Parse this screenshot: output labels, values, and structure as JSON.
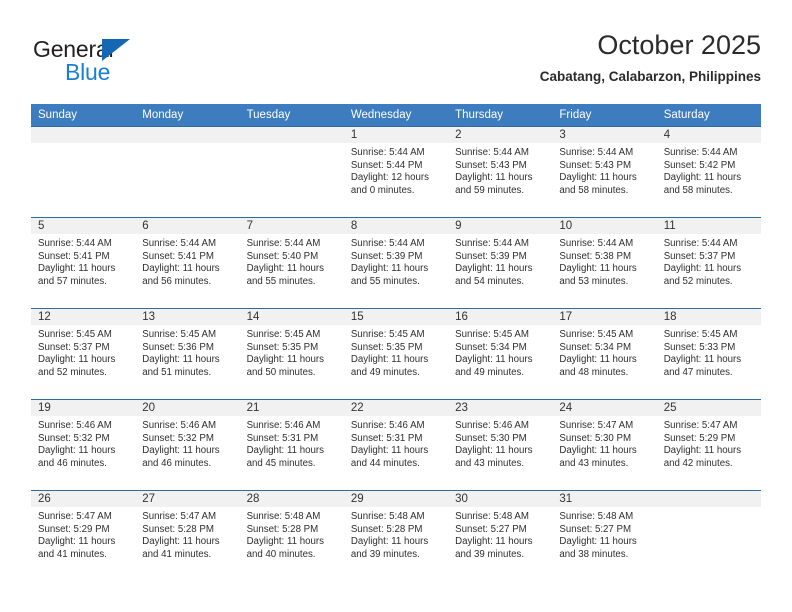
{
  "brand": {
    "name_top": "General",
    "name_bottom": "Blue",
    "triangle_color": "#1567b3",
    "blue_text_color": "#1a7fd4"
  },
  "header": {
    "title": "October 2025",
    "subtitle": "Cabatang, Calabarzon, Philippines"
  },
  "theme": {
    "header_row_bg": "#3c7cbf",
    "row_border": "#2e6da4",
    "daynum_bg": "#f1f1f1",
    "text": "#2f2f2f"
  },
  "weekday_headers": [
    "Sunday",
    "Monday",
    "Tuesday",
    "Wednesday",
    "Thursday",
    "Friday",
    "Saturday"
  ],
  "labels": {
    "sunrise_prefix": "Sunrise:",
    "sunset_prefix": "Sunset:",
    "daylight_prefix": "Daylight:"
  },
  "weeks": [
    [
      {
        "day": "",
        "sunrise": "",
        "sunset": "",
        "daylight_line1": "",
        "daylight_line2": ""
      },
      {
        "day": "",
        "sunrise": "",
        "sunset": "",
        "daylight_line1": "",
        "daylight_line2": ""
      },
      {
        "day": "",
        "sunrise": "",
        "sunset": "",
        "daylight_line1": "",
        "daylight_line2": ""
      },
      {
        "day": "1",
        "sunrise": "Sunrise: 5:44 AM",
        "sunset": "Sunset: 5:44 PM",
        "daylight_line1": "Daylight: 12 hours",
        "daylight_line2": "and 0 minutes."
      },
      {
        "day": "2",
        "sunrise": "Sunrise: 5:44 AM",
        "sunset": "Sunset: 5:43 PM",
        "daylight_line1": "Daylight: 11 hours",
        "daylight_line2": "and 59 minutes."
      },
      {
        "day": "3",
        "sunrise": "Sunrise: 5:44 AM",
        "sunset": "Sunset: 5:43 PM",
        "daylight_line1": "Daylight: 11 hours",
        "daylight_line2": "and 58 minutes."
      },
      {
        "day": "4",
        "sunrise": "Sunrise: 5:44 AM",
        "sunset": "Sunset: 5:42 PM",
        "daylight_line1": "Daylight: 11 hours",
        "daylight_line2": "and 58 minutes."
      }
    ],
    [
      {
        "day": "5",
        "sunrise": "Sunrise: 5:44 AM",
        "sunset": "Sunset: 5:41 PM",
        "daylight_line1": "Daylight: 11 hours",
        "daylight_line2": "and 57 minutes."
      },
      {
        "day": "6",
        "sunrise": "Sunrise: 5:44 AM",
        "sunset": "Sunset: 5:41 PM",
        "daylight_line1": "Daylight: 11 hours",
        "daylight_line2": "and 56 minutes."
      },
      {
        "day": "7",
        "sunrise": "Sunrise: 5:44 AM",
        "sunset": "Sunset: 5:40 PM",
        "daylight_line1": "Daylight: 11 hours",
        "daylight_line2": "and 55 minutes."
      },
      {
        "day": "8",
        "sunrise": "Sunrise: 5:44 AM",
        "sunset": "Sunset: 5:39 PM",
        "daylight_line1": "Daylight: 11 hours",
        "daylight_line2": "and 55 minutes."
      },
      {
        "day": "9",
        "sunrise": "Sunrise: 5:44 AM",
        "sunset": "Sunset: 5:39 PM",
        "daylight_line1": "Daylight: 11 hours",
        "daylight_line2": "and 54 minutes."
      },
      {
        "day": "10",
        "sunrise": "Sunrise: 5:44 AM",
        "sunset": "Sunset: 5:38 PM",
        "daylight_line1": "Daylight: 11 hours",
        "daylight_line2": "and 53 minutes."
      },
      {
        "day": "11",
        "sunrise": "Sunrise: 5:44 AM",
        "sunset": "Sunset: 5:37 PM",
        "daylight_line1": "Daylight: 11 hours",
        "daylight_line2": "and 52 minutes."
      }
    ],
    [
      {
        "day": "12",
        "sunrise": "Sunrise: 5:45 AM",
        "sunset": "Sunset: 5:37 PM",
        "daylight_line1": "Daylight: 11 hours",
        "daylight_line2": "and 52 minutes."
      },
      {
        "day": "13",
        "sunrise": "Sunrise: 5:45 AM",
        "sunset": "Sunset: 5:36 PM",
        "daylight_line1": "Daylight: 11 hours",
        "daylight_line2": "and 51 minutes."
      },
      {
        "day": "14",
        "sunrise": "Sunrise: 5:45 AM",
        "sunset": "Sunset: 5:35 PM",
        "daylight_line1": "Daylight: 11 hours",
        "daylight_line2": "and 50 minutes."
      },
      {
        "day": "15",
        "sunrise": "Sunrise: 5:45 AM",
        "sunset": "Sunset: 5:35 PM",
        "daylight_line1": "Daylight: 11 hours",
        "daylight_line2": "and 49 minutes."
      },
      {
        "day": "16",
        "sunrise": "Sunrise: 5:45 AM",
        "sunset": "Sunset: 5:34 PM",
        "daylight_line1": "Daylight: 11 hours",
        "daylight_line2": "and 49 minutes."
      },
      {
        "day": "17",
        "sunrise": "Sunrise: 5:45 AM",
        "sunset": "Sunset: 5:34 PM",
        "daylight_line1": "Daylight: 11 hours",
        "daylight_line2": "and 48 minutes."
      },
      {
        "day": "18",
        "sunrise": "Sunrise: 5:45 AM",
        "sunset": "Sunset: 5:33 PM",
        "daylight_line1": "Daylight: 11 hours",
        "daylight_line2": "and 47 minutes."
      }
    ],
    [
      {
        "day": "19",
        "sunrise": "Sunrise: 5:46 AM",
        "sunset": "Sunset: 5:32 PM",
        "daylight_line1": "Daylight: 11 hours",
        "daylight_line2": "and 46 minutes."
      },
      {
        "day": "20",
        "sunrise": "Sunrise: 5:46 AM",
        "sunset": "Sunset: 5:32 PM",
        "daylight_line1": "Daylight: 11 hours",
        "daylight_line2": "and 46 minutes."
      },
      {
        "day": "21",
        "sunrise": "Sunrise: 5:46 AM",
        "sunset": "Sunset: 5:31 PM",
        "daylight_line1": "Daylight: 11 hours",
        "daylight_line2": "and 45 minutes."
      },
      {
        "day": "22",
        "sunrise": "Sunrise: 5:46 AM",
        "sunset": "Sunset: 5:31 PM",
        "daylight_line1": "Daylight: 11 hours",
        "daylight_line2": "and 44 minutes."
      },
      {
        "day": "23",
        "sunrise": "Sunrise: 5:46 AM",
        "sunset": "Sunset: 5:30 PM",
        "daylight_line1": "Daylight: 11 hours",
        "daylight_line2": "and 43 minutes."
      },
      {
        "day": "24",
        "sunrise": "Sunrise: 5:47 AM",
        "sunset": "Sunset: 5:30 PM",
        "daylight_line1": "Daylight: 11 hours",
        "daylight_line2": "and 43 minutes."
      },
      {
        "day": "25",
        "sunrise": "Sunrise: 5:47 AM",
        "sunset": "Sunset: 5:29 PM",
        "daylight_line1": "Daylight: 11 hours",
        "daylight_line2": "and 42 minutes."
      }
    ],
    [
      {
        "day": "26",
        "sunrise": "Sunrise: 5:47 AM",
        "sunset": "Sunset: 5:29 PM",
        "daylight_line1": "Daylight: 11 hours",
        "daylight_line2": "and 41 minutes."
      },
      {
        "day": "27",
        "sunrise": "Sunrise: 5:47 AM",
        "sunset": "Sunset: 5:28 PM",
        "daylight_line1": "Daylight: 11 hours",
        "daylight_line2": "and 41 minutes."
      },
      {
        "day": "28",
        "sunrise": "Sunrise: 5:48 AM",
        "sunset": "Sunset: 5:28 PM",
        "daylight_line1": "Daylight: 11 hours",
        "daylight_line2": "and 40 minutes."
      },
      {
        "day": "29",
        "sunrise": "Sunrise: 5:48 AM",
        "sunset": "Sunset: 5:28 PM",
        "daylight_line1": "Daylight: 11 hours",
        "daylight_line2": "and 39 minutes."
      },
      {
        "day": "30",
        "sunrise": "Sunrise: 5:48 AM",
        "sunset": "Sunset: 5:27 PM",
        "daylight_line1": "Daylight: 11 hours",
        "daylight_line2": "and 39 minutes."
      },
      {
        "day": "31",
        "sunrise": "Sunrise: 5:48 AM",
        "sunset": "Sunset: 5:27 PM",
        "daylight_line1": "Daylight: 11 hours",
        "daylight_line2": "and 38 minutes."
      },
      {
        "day": "",
        "sunrise": "",
        "sunset": "",
        "daylight_line1": "",
        "daylight_line2": ""
      }
    ]
  ]
}
